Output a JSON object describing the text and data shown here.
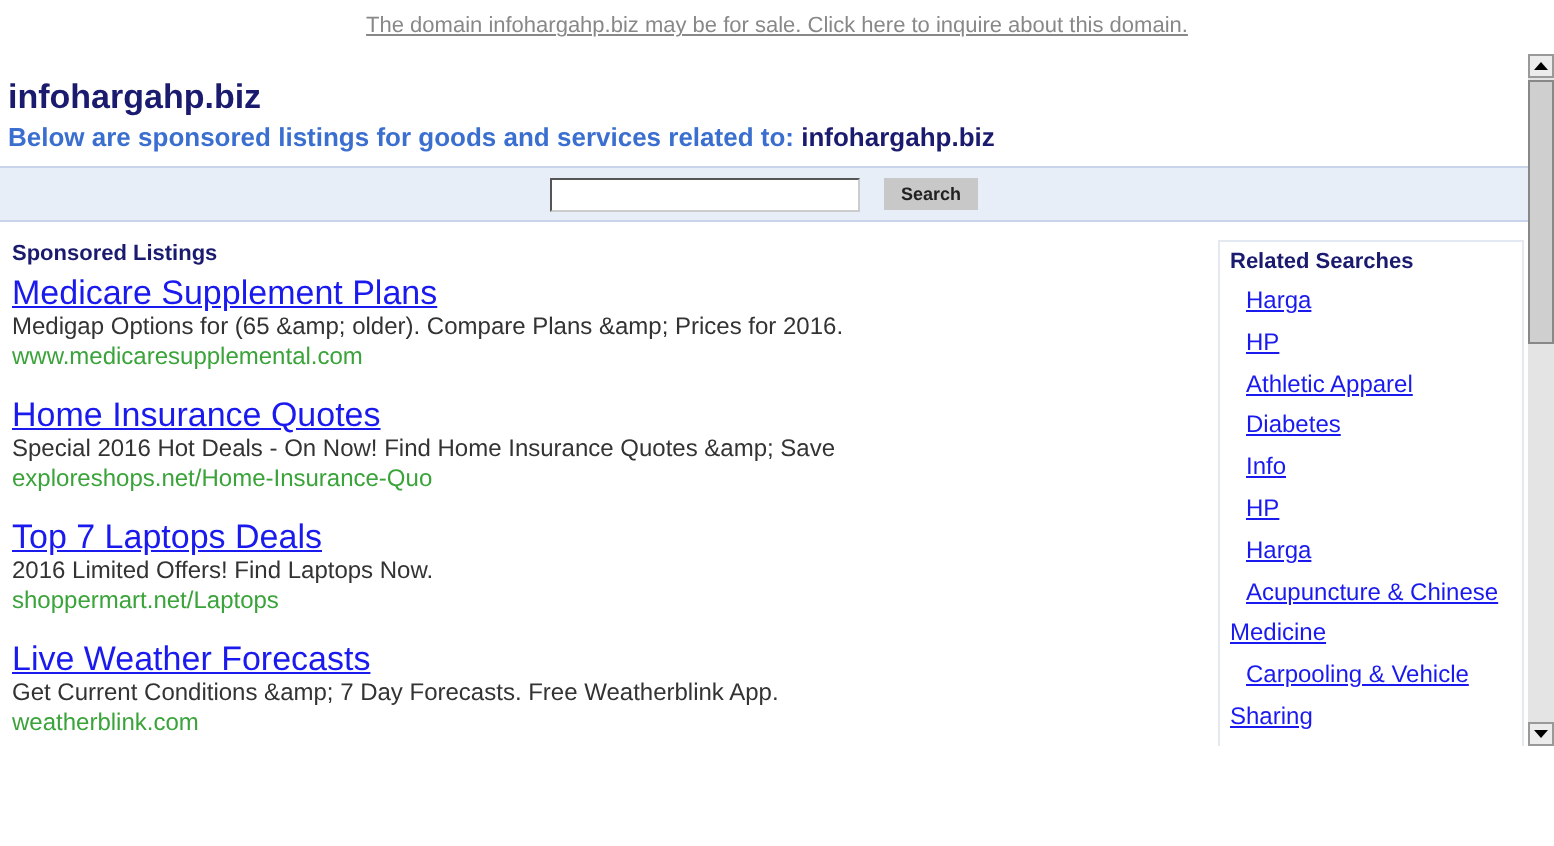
{
  "sale_notice": "The domain infohargahp.biz may be for sale. Click here to inquire about this domain.",
  "header": {
    "title": "infohargahp.biz",
    "subtitle": "Below are sponsored listings for goods and services related to:",
    "subtitle_domain": "infohargahp.biz"
  },
  "search": {
    "button": "Search"
  },
  "sponsored": {
    "heading": "Sponsored Listings",
    "listings": [
      {
        "title": "Medicare Supplement Plans",
        "description": "Medigap Options for (65 &amp; older). Compare Plans &amp; Prices for 2016.",
        "url": "www.medicaresupplemental.com"
      },
      {
        "title": "Home Insurance Quotes",
        "description": "Special 2016 Hot Deals - On Now! Find Home Insurance Quotes &amp; Save",
        "url": "exploreshops.net/Home-Insurance-Quo"
      },
      {
        "title": "Top 7 Laptops Deals",
        "description": "2016 Limited Offers! Find Laptops Now.",
        "url": "shoppermart.net/Laptops"
      },
      {
        "title": "Live Weather Forecasts",
        "description": "Get Current Conditions &amp; 7 Day Forecasts. Free Weatherblink App.",
        "url": "weatherblink.com"
      }
    ]
  },
  "related": {
    "heading": "Related Searches",
    "links": [
      "Harga",
      "HP",
      "Athletic Apparel",
      "Diabetes",
      "Info",
      "HP",
      "Harga",
      "Acupuncture & Chinese Medicine",
      "Carpooling & Vehicle Sharing"
    ]
  }
}
